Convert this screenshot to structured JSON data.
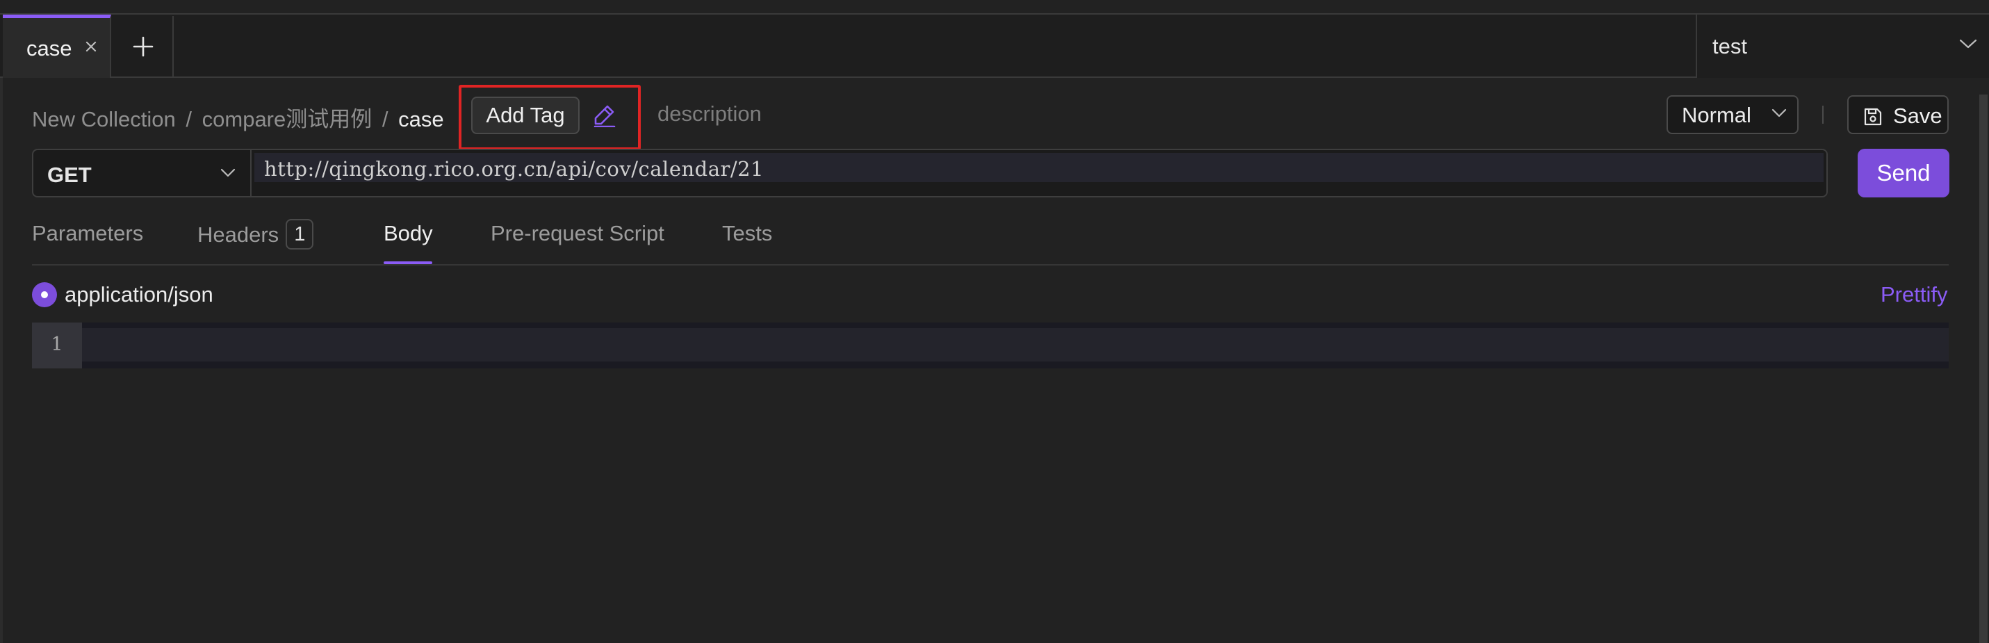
{
  "tabs": [
    {
      "label": "case",
      "active": true
    }
  ],
  "environment": {
    "selected": "test"
  },
  "breadcrumb": {
    "collection": "New Collection",
    "folder": "compare测试用例",
    "current": "case",
    "separator": "/"
  },
  "tag": {
    "add_label": "Add Tag"
  },
  "description": {
    "placeholder": "description"
  },
  "mode_select": {
    "selected": "Normal"
  },
  "save": {
    "label": "Save"
  },
  "request": {
    "method": "GET",
    "url": "http://qingkong.rico.org.cn/api/cov/calendar/21",
    "send_label": "Send"
  },
  "request_tabs": {
    "parameters": "Parameters",
    "headers": "Headers",
    "headers_count": "1",
    "body": "Body",
    "pre_request": "Pre-request Script",
    "tests": "Tests",
    "active": "Body"
  },
  "body": {
    "content_type": "application/json",
    "prettify_label": "Prettify",
    "line_numbers": [
      "1"
    ]
  },
  "colors": {
    "accent": "#8b5cf6",
    "send_button": "#7c4ddb",
    "highlight_box": "#e02424",
    "background": "#222222"
  },
  "icons": {
    "tab_close": "close-icon",
    "new_tab": "plus-icon",
    "dropdown": "chevron-down-icon",
    "edit": "pencil-icon",
    "save": "floppy-disk-icon"
  }
}
